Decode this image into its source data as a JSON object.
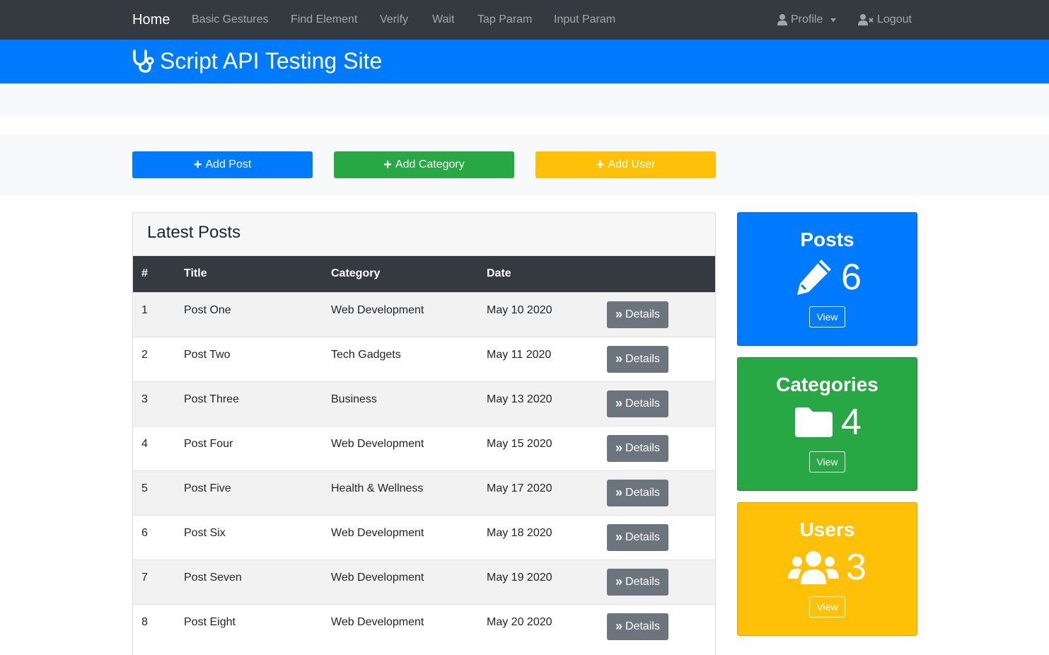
{
  "navbar": {
    "brand": "Home",
    "links": [
      "Basic Gestures",
      "Find Element",
      "Verify",
      "Wait",
      "Tap Param",
      "Input Param"
    ],
    "profile_label": "Profile",
    "logout_label": "Logout"
  },
  "header": {
    "title": "Script API Testing Site"
  },
  "actions": {
    "add_post": "Add Post",
    "add_category": "Add Category",
    "add_user": "Add User"
  },
  "posts": {
    "heading": "Latest Posts",
    "columns": [
      "#",
      "Title",
      "Category",
      "Date"
    ],
    "details_label": "Details",
    "rows": [
      {
        "num": "1",
        "title": "Post One",
        "category": "Web Development",
        "date": "May 10 2020"
      },
      {
        "num": "2",
        "title": "Post Two",
        "category": "Tech Gadgets",
        "date": "May 11 2020"
      },
      {
        "num": "3",
        "title": "Post Three",
        "category": "Business",
        "date": "May 13 2020"
      },
      {
        "num": "4",
        "title": "Post Four",
        "category": "Web Development",
        "date": "May 15 2020"
      },
      {
        "num": "5",
        "title": "Post Five",
        "category": "Health & Wellness",
        "date": "May 17 2020"
      },
      {
        "num": "6",
        "title": "Post Six",
        "category": "Web Development",
        "date": "May 18 2020"
      },
      {
        "num": "7",
        "title": "Post Seven",
        "category": "Web Development",
        "date": "May 19 2020"
      },
      {
        "num": "8",
        "title": "Post Eight",
        "category": "Web Development",
        "date": "May 20 2020"
      }
    ]
  },
  "stats": {
    "posts": {
      "title": "Posts",
      "count": "6",
      "view": "View",
      "icon": "pencil-icon"
    },
    "categories": {
      "title": "Categories",
      "count": "4",
      "view": "View",
      "icon": "folder-icon"
    },
    "users": {
      "title": "Users",
      "count": "3",
      "view": "View",
      "icon": "users-icon"
    }
  },
  "colors": {
    "navbar": "#343a40",
    "primary": "#007bff",
    "success": "#28a745",
    "warning": "#ffc107",
    "secondary": "#6c757d"
  }
}
